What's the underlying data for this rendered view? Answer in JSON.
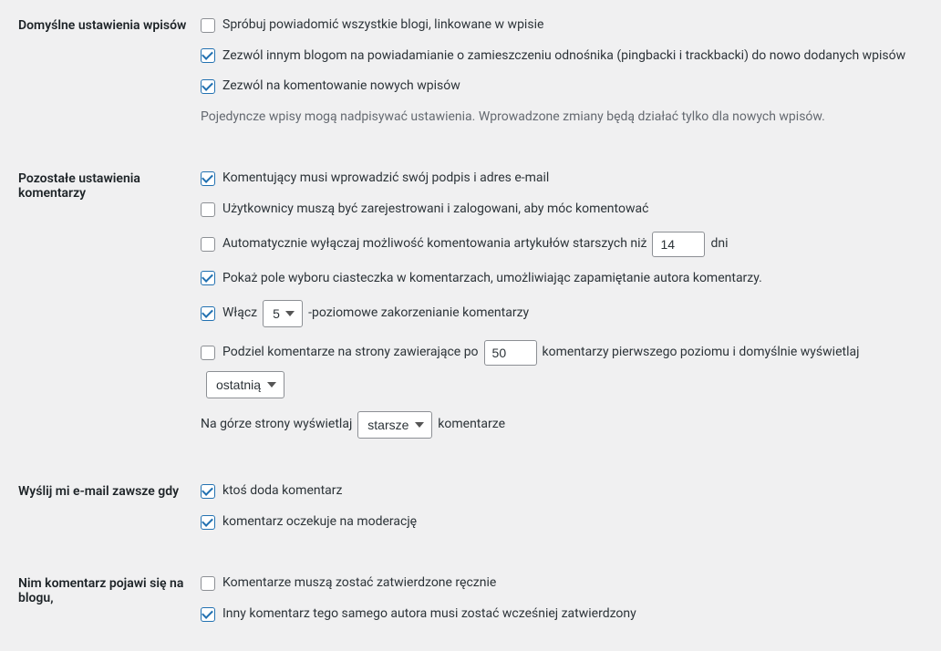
{
  "sections": {
    "default_post": {
      "label": "Domyślne ustawienia wpisów",
      "opt1": "Spróbuj powiadomić wszystkie blogi, linkowane w wpisie",
      "opt2": "Zezwól innym blogom na powiadamianie o zamieszczeniu odnośnika (pingbacki i trackbacki) do nowo dodanych wpisów",
      "opt3": "Zezwól na komentowanie nowych wpisów",
      "desc": "Pojedyncze wpisy mogą nadpisywać ustawienia. Wprowadzone zmiany będą działać tylko dla nowych wpisów."
    },
    "other_comment": {
      "label": "Pozostałe ustawienia komentarzy",
      "opt1": "Komentujący musi wprowadzić swój podpis i adres e-mail",
      "opt2": "Użytkownicy muszą być zarejestrowani i zalogowani, aby móc komentować",
      "opt3_pre": "Automatycznie wyłączaj możliwość komentowania artykułów starszych niż",
      "opt3_days_value": "14",
      "opt3_post": "dni",
      "opt4": "Pokaż pole wyboru ciasteczka w komentarzach, umożliwiając zapamiętanie autora komentarzy.",
      "opt5_pre": "Włącz",
      "opt5_select_value": "5",
      "opt5_post": "-poziomowe zakorzenianie komentarzy",
      "opt6_pre": "Podziel komentarze na strony zawierające po",
      "opt6_num_value": "50",
      "opt6_mid": "komentarzy pierwszego poziomu i domyślnie wyświetlaj",
      "opt6_select_value": "ostatnią",
      "opt7_pre": "Na górze strony wyświetlaj",
      "opt7_select_value": "starsze",
      "opt7_post": "komentarze"
    },
    "email_me": {
      "label": "Wyślij mi e-mail zawsze gdy",
      "opt1": "ktoś doda komentarz",
      "opt2": "komentarz oczekuje na moderację"
    },
    "before_appear": {
      "label": "Nim komentarz pojawi się na blogu,",
      "opt1": "Komentarze muszą zostać zatwierdzone ręcznie",
      "opt2": "Inny komentarz tego samego autora musi zostać wcześniej zatwierdzony"
    }
  }
}
